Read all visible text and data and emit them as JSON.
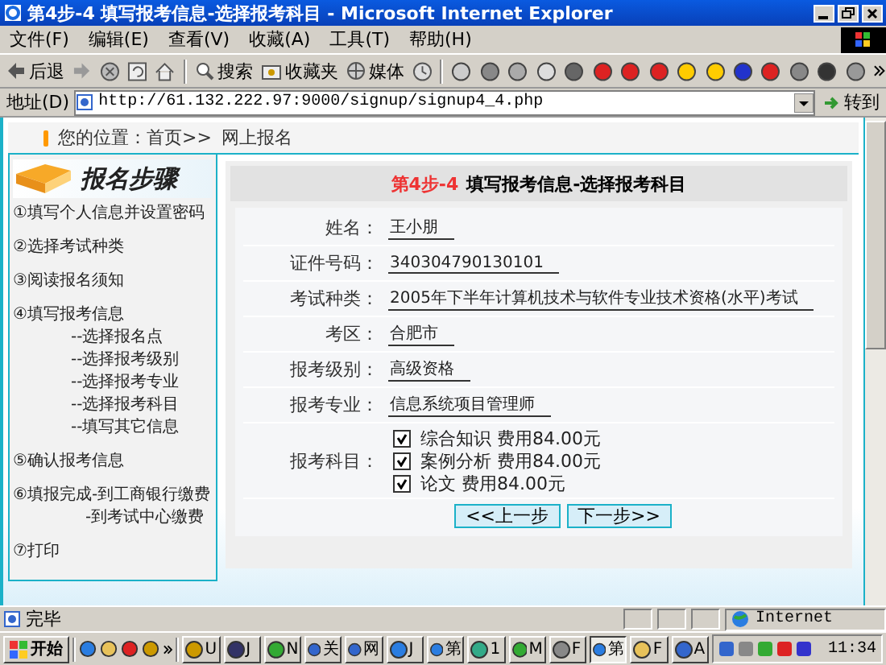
{
  "window": {
    "title": "第4步-4 填写报考信息-选择报考科目 - Microsoft Internet Explorer"
  },
  "menu": [
    "文件(F)",
    "编辑(E)",
    "查看(V)",
    "收藏(A)",
    "工具(T)",
    "帮助(H)"
  ],
  "toolbar": {
    "back": "后退",
    "search": "搜索",
    "favorites": "收藏夹",
    "media": "媒体"
  },
  "address": {
    "label": "地址(D)",
    "value": "http://61.132.222.97:9000/signup/signup4_4.php",
    "go": "转到"
  },
  "breadcrumb": {
    "path": "您的位置：首页>>",
    "current": "网上报名"
  },
  "sidebar": {
    "title": "报名步骤",
    "steps": [
      {
        "label": "①填写个人信息并设置密码"
      },
      {
        "label": "②选择考试种类"
      },
      {
        "label": "③阅读报名须知"
      },
      {
        "label": "④填写报考信息",
        "children": [
          {
            "label": "--选择报名点"
          },
          {
            "label": "--选择报考级别"
          },
          {
            "label": "--选择报考专业"
          },
          {
            "label": "--选择报考科目"
          },
          {
            "label": "--填写其它信息"
          }
        ]
      },
      {
        "label": "⑤确认报考信息"
      },
      {
        "label": "⑥填报完成-到工商银行缴费",
        "children": [
          {
            "label": "-到考试中心缴费"
          }
        ]
      },
      {
        "label": "⑦打印"
      }
    ]
  },
  "form": {
    "step": "第4步-4",
    "title": "填写报考信息-选择报考科目",
    "fields": [
      {
        "label": "姓名：",
        "value": "王小朋"
      },
      {
        "label": "证件号码：",
        "value": "340304790130101"
      },
      {
        "label": "考试种类：",
        "value": "2005年下半年计算机技术与软件专业技术资格(水平)考试"
      },
      {
        "label": "考区：",
        "value": "合肥市"
      },
      {
        "label": "报考级别：",
        "value": "高级资格"
      },
      {
        "label": "报考专业：",
        "value": "信息系统项目管理师"
      }
    ],
    "subjects_label": "报考科目：",
    "subjects": [
      {
        "label": "综合知识 费用84.00元",
        "checked": true
      },
      {
        "label": "案例分析 费用84.00元",
        "checked": true
      },
      {
        "label": "论文 费用84.00元",
        "checked": true
      }
    ],
    "buttons": [
      "<<上一步",
      "下一步>>"
    ]
  },
  "status_bar": {
    "text": "完毕",
    "zone": "Internet"
  },
  "taskbar": {
    "start": "开始",
    "buttons": [
      {
        "label": "U",
        "selected": false
      },
      {
        "label": "J",
        "selected": false
      },
      {
        "label": "N",
        "selected": false
      },
      {
        "label": "关",
        "selected": false
      },
      {
        "label": "网",
        "selected": false
      },
      {
        "label": "J",
        "selected": false
      },
      {
        "label": "第",
        "selected": false
      },
      {
        "label": "1",
        "selected": false
      },
      {
        "label": "M",
        "selected": false
      },
      {
        "label": "F",
        "selected": false
      },
      {
        "label": "第",
        "selected": true
      },
      {
        "label": "F",
        "selected": false
      },
      {
        "label": "A",
        "selected": false
      }
    ],
    "time": "11:34"
  }
}
